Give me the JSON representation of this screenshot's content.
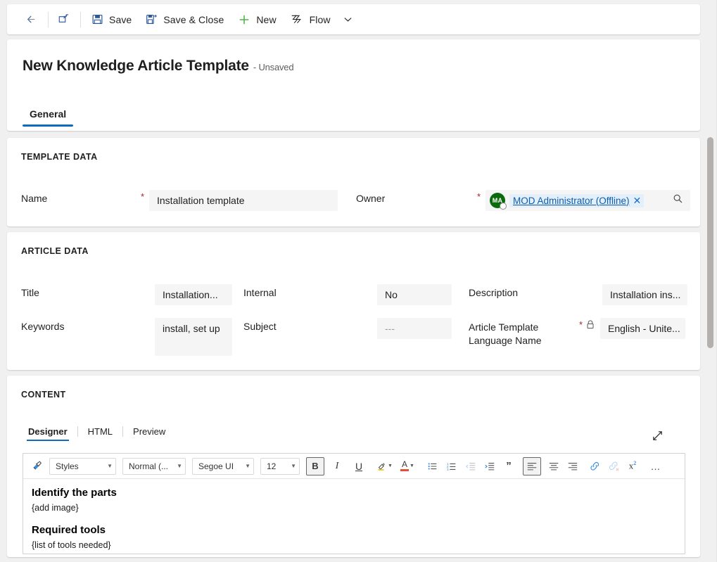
{
  "commandbar": {
    "back_label": "Back",
    "popout_label": "Open in new window",
    "save_label": "Save",
    "save_close_label": "Save & Close",
    "new_label": "New",
    "flow_label": "Flow",
    "flow_caret_label": "More",
    "icons": {
      "back": "arrow-left-icon",
      "popout": "pop-out-icon",
      "save": "save-disk-icon",
      "save_close": "save-and-close-icon",
      "new": "plus-icon",
      "flow": "flow-icon",
      "chevron": "chevron-down-icon"
    },
    "accent_green": "#4bb543",
    "icon_blue": "#2b579a"
  },
  "header": {
    "title": "New Knowledge Article Template",
    "subtitle": "- Unsaved",
    "tabs": [
      {
        "label": "General",
        "active": true
      }
    ]
  },
  "sections": {
    "template_data": {
      "title": "TEMPLATE DATA",
      "fields": {
        "name": {
          "label": "Name",
          "required": "*",
          "value": "Installation template"
        },
        "owner": {
          "label": "Owner",
          "required": "*",
          "avatar_initials": "MA",
          "avatar_color": "#0b6a0b",
          "value": "MOD Administrator (Offline)",
          "clear_label": "✕",
          "search_label": "Search records"
        }
      }
    },
    "article_data": {
      "title": "ARTICLE DATA",
      "fields": {
        "title": {
          "label": "Title",
          "value": "Installation..."
        },
        "internal": {
          "label": "Internal",
          "value": "No"
        },
        "description": {
          "label": "Description",
          "value": "Installation ins..."
        },
        "keywords": {
          "label": "Keywords",
          "value": "install, set up"
        },
        "subject": {
          "label": "Subject",
          "value": "---"
        },
        "language": {
          "label": "Article Template Language Name",
          "required": "*",
          "locked": true,
          "value": "English - Unite..."
        }
      }
    },
    "content": {
      "title": "CONTENT",
      "tabs": [
        {
          "label": "Designer",
          "active": true
        },
        {
          "label": "HTML",
          "active": false
        },
        {
          "label": "Preview",
          "active": false
        }
      ],
      "expand_label": "Expand editor"
    }
  },
  "editor": {
    "toolbar": {
      "format_painter": "Format painter",
      "styles": "Styles",
      "format": "Normal (...",
      "font": "Segoe UI",
      "size": "12",
      "bold": "B",
      "italic": "I",
      "underline": "U",
      "highlight": "Text highlight color",
      "fontcolor": "A",
      "bullets": "Bulleted list",
      "numbering": "Numbered list",
      "outdent": "Decrease indent",
      "indent": "Increase indent",
      "quote": "”",
      "align_left": "Align left",
      "align_center": "Align center",
      "align_right": "Align right",
      "link": "Insert link",
      "unlink": "Remove link",
      "superscript": "Superscript",
      "more": "…"
    },
    "content_blocks": [
      {
        "type": "heading",
        "text": "Identify the parts"
      },
      {
        "type": "paragraph",
        "text": "{add image}"
      },
      {
        "type": "heading",
        "text": "Required tools"
      },
      {
        "type": "paragraph",
        "text": "{list of tools needed}"
      }
    ]
  },
  "colors": {
    "accent_blue": "#0f6cbd",
    "required_red": "#a4262c",
    "link_blue": "#0f5ca8",
    "page_bg": "#f0f0f0",
    "field_bg": "#f5f5f5"
  }
}
